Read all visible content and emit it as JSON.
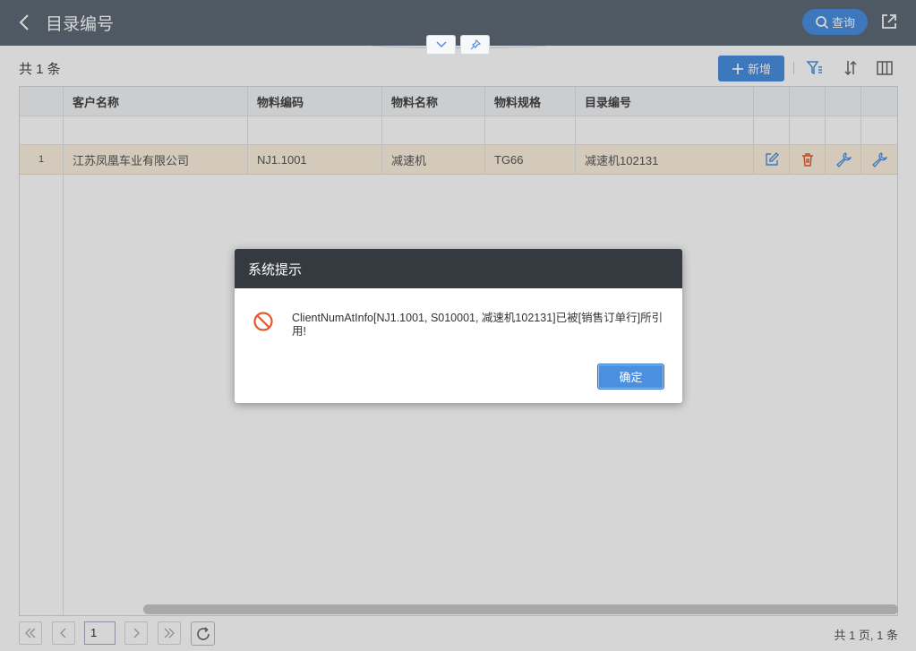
{
  "header": {
    "title": "目录编号",
    "query_label": "查询",
    "back_icon": "chevron-left-icon",
    "share_icon": "share-icon"
  },
  "toolbar": {
    "count_text": "共 1 条",
    "add_label": "新增"
  },
  "table": {
    "columns": [
      "客户名称",
      "物料编码",
      "物料名称",
      "物料规格",
      "目录编号"
    ],
    "rows": [
      {
        "index": "1",
        "customer": "江苏凤凰车业有限公司",
        "material_code": "NJ1.1001",
        "material_name": "减速机",
        "spec": "TG66",
        "catalog_no": "减速机102131"
      }
    ]
  },
  "pager": {
    "current_page": "1",
    "summary": "共 1 页, 1 条"
  },
  "dialog": {
    "title": "系统提示",
    "message": "ClientNumAtInfo[NJ1.1001, S010001, 减速机102131]已被[销售订单行]所引用!",
    "ok_label": "确定",
    "icon": "forbidden-icon"
  },
  "colors": {
    "header_bg": "#5f6a76",
    "accent": "#4a8fe0",
    "selected_row": "#fdf1e0",
    "dialog_head": "#343a40",
    "danger": "#e4572e"
  }
}
